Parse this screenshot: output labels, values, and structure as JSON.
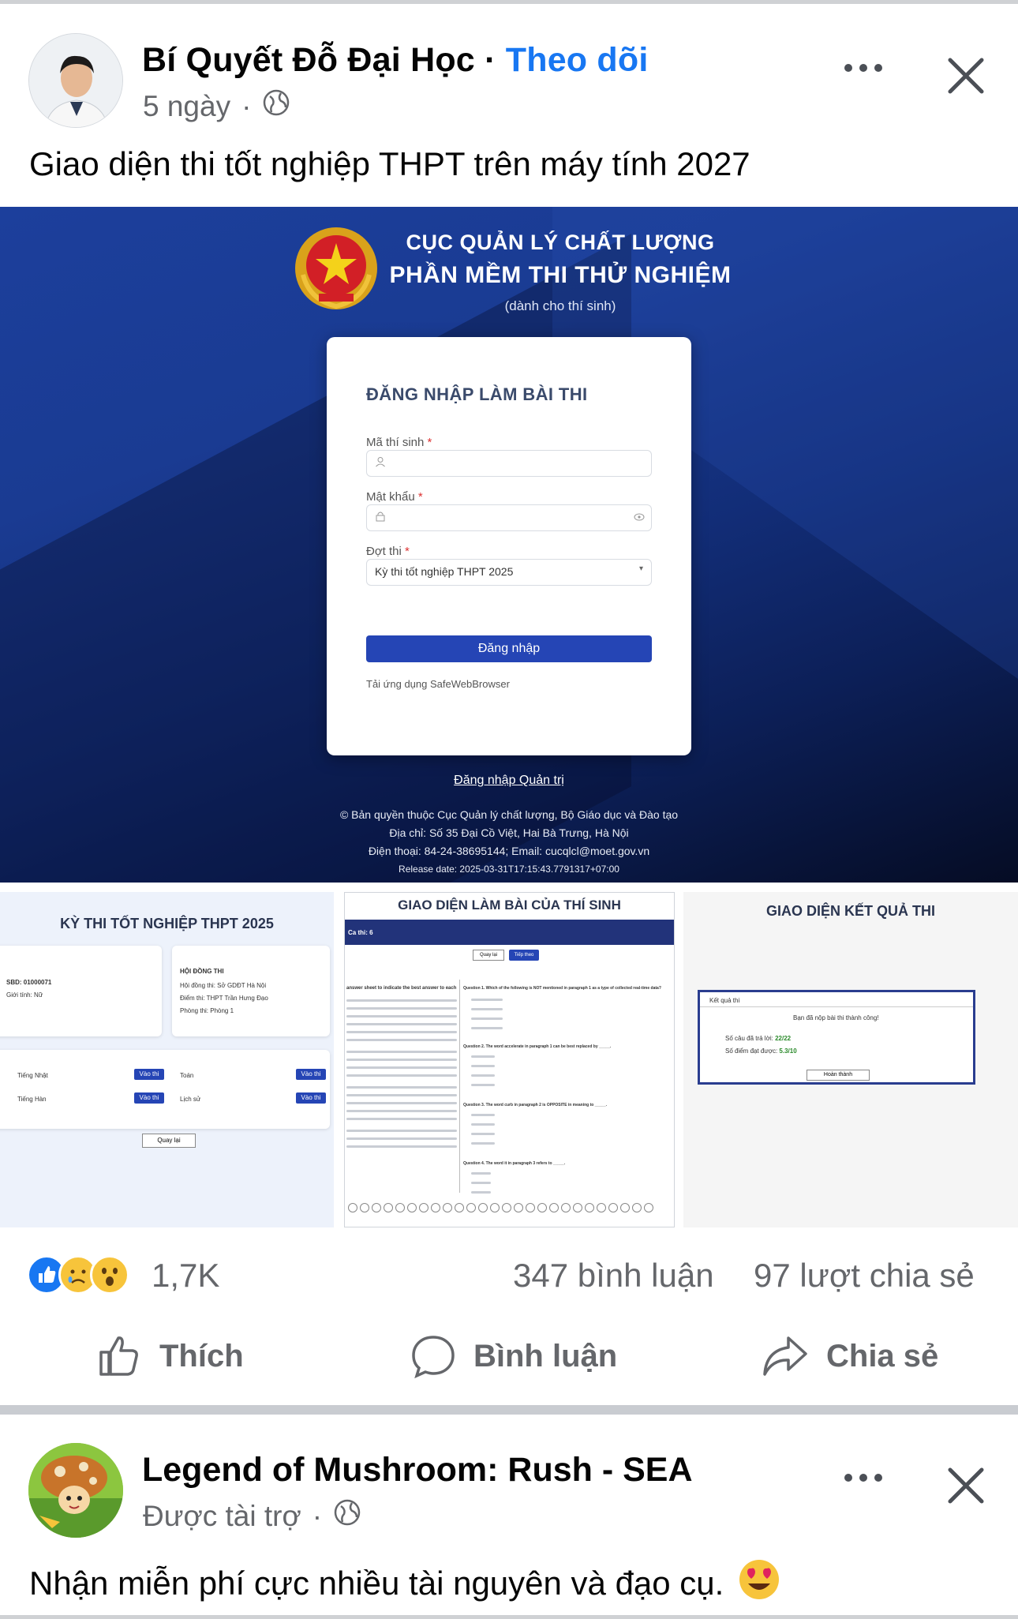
{
  "post": {
    "author": "Bí Quyết Đỗ Đại Học",
    "separator": "·",
    "follow_label": "Theo dõi",
    "time": "5 ngày",
    "meta_dot": "·",
    "audience_icon": "globe-icon",
    "text": "Giao diện thi tốt nghiệp THPT trên máy tính 2027"
  },
  "main_image": {
    "org_line1": "CỤC QUẢN LÝ CHẤT LƯỢNG",
    "org_line2": "PHẦN MỀM THI THỬ NGHIỆM",
    "org_line3": "(dành cho thí sinh)",
    "login_title": "ĐĂNG NHẬP LÀM BÀI THI",
    "candidate_label": "Mã thí sinh",
    "password_label": "Mật khẩu",
    "exam_label": "Đợt thi",
    "required_mark": "*",
    "exam_value": "Kỳ thi tốt nghiệp THPT 2025",
    "login_button": "Đăng nhập",
    "download_link": "Tải ứng dụng SafeWebBrowser",
    "admin_link": "Đăng nhập Quản trị",
    "footer1": "© Bản quyền thuộc Cục Quản lý chất lượng, Bộ Giáo dục và Đào tạo",
    "footer2": "Địa chỉ: Số 35 Đại Cồ Việt, Hai Bà Trưng, Hà Nội",
    "footer3": "Điện thoại: 84-24-38695144; Email: cucqlcl@moet.gov.vn",
    "footer4": "Release date: 2025-03-31T17:15:43.7791317+07:00"
  },
  "thumb1": {
    "title": "KỲ THI TỐT NGHIỆP THPT 2025",
    "sbd": "SBD: 01000071",
    "gender": "Giới tính: Nữ",
    "council_title": "HỘI ĐỒNG THI",
    "council": "Hội đồng thi: Sở GDĐT Hà Nội",
    "site": "Điểm thi: THPT Trần Hưng Đạo",
    "room": "Phòng thi: Phòng 1",
    "subj1": "Tiếng Nhật",
    "subj2": "Tiếng Hàn",
    "subj3": "Toán",
    "subj4": "Lịch sử",
    "enter": "Vào thi",
    "back": "Quay lại"
  },
  "thumb2": {
    "title": "GIAO DIỆN LÀM BÀI CỦA THÍ SINH",
    "bar_text": "Ca thi: 6",
    "back": "Quay lại",
    "next": "Tiếp theo",
    "q1": "Question 1. Which of the following is NOT mentioned in paragraph 1 as a type of collected real-time data?",
    "q2": "Question 2. The word accelerate in paragraph 1 can be best replaced by _____.",
    "q3": "Question 3. The word curb in paragraph 2 is OPPOSITE in meaning to _____.",
    "q4": "Question 4. The word it in paragraph 3 refers to _____.",
    "passage_head": "answer sheet to indicate the best answer to each"
  },
  "thumb3": {
    "title": "GIAO DIỆN KẾT QUẢ THI",
    "box_label": "Kết quả thi",
    "message": "Bạn đã nộp bài thi thành công!",
    "answered_label": "Số câu đã trả lời:",
    "answered_value": "22/22",
    "score_label": "Số điểm đạt được:",
    "score_value": "5.3/10",
    "done": "Hoàn thành"
  },
  "stats": {
    "reactions": "1,7K",
    "comments": "347 bình luận",
    "shares": "97 lượt chia sẻ"
  },
  "actions": {
    "like": "Thích",
    "comment": "Bình luận",
    "share": "Chia sẻ"
  },
  "ad": {
    "author": "Legend of Mushroom: Rush - SEA",
    "sponsored": "Được tài trợ",
    "meta_dot": "·",
    "text": "Nhận miễn phí cực nhiều tài nguyên và đạo cụ."
  },
  "colors": {
    "link_blue": "#1877f2",
    "secondary_text": "#65676b",
    "primary_button": "#2545b5"
  }
}
